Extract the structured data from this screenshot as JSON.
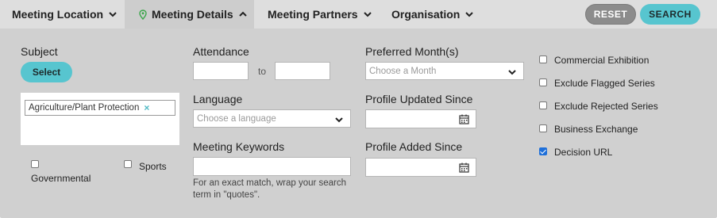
{
  "nav": {
    "location": "Meeting Location",
    "details": "Meeting Details",
    "partners": "Meeting Partners",
    "organisation": "Organisation"
  },
  "actions": {
    "reset": "RESET",
    "search": "SEARCH"
  },
  "subject": {
    "label": "Subject",
    "select_button": "Select",
    "selected_tag": "Agriculture/Plant Protection",
    "remove_symbol": "×"
  },
  "categories": {
    "governmental": {
      "label": "Governmental",
      "checked": false
    },
    "sports": {
      "label": "Sports",
      "checked": false
    }
  },
  "attendance": {
    "label": "Attendance",
    "from": "",
    "to_label": "to",
    "to": ""
  },
  "language": {
    "label": "Language",
    "placeholder": "Choose a language"
  },
  "keywords": {
    "label": "Meeting Keywords",
    "value": "",
    "hint": "For an exact match, wrap your search term in \"quotes\"."
  },
  "preferred_months": {
    "label": "Preferred Month(s)",
    "placeholder": "Choose a Month"
  },
  "profile_updated": {
    "label": "Profile Updated Since",
    "value": ""
  },
  "profile_added": {
    "label": "Profile Added Since",
    "value": ""
  },
  "filters": [
    {
      "label": "Commercial Exhibition",
      "checked": false
    },
    {
      "label": "Exclude Flagged Series",
      "checked": false
    },
    {
      "label": "Exclude Rejected Series",
      "checked": false
    },
    {
      "label": "Business Exchange",
      "checked": false
    },
    {
      "label": "Decision URL",
      "checked": true
    }
  ],
  "colors": {
    "accent": "#57c5cf",
    "reset_button": "#8c8c8c",
    "panel": "#d0d0d0",
    "checked": "#1e6fd9"
  },
  "icons": {
    "pin": "map-pin-icon",
    "chevron": "chevron-down-icon",
    "chevron_up": "chevron-up-icon",
    "calendar": "calendar-icon"
  }
}
